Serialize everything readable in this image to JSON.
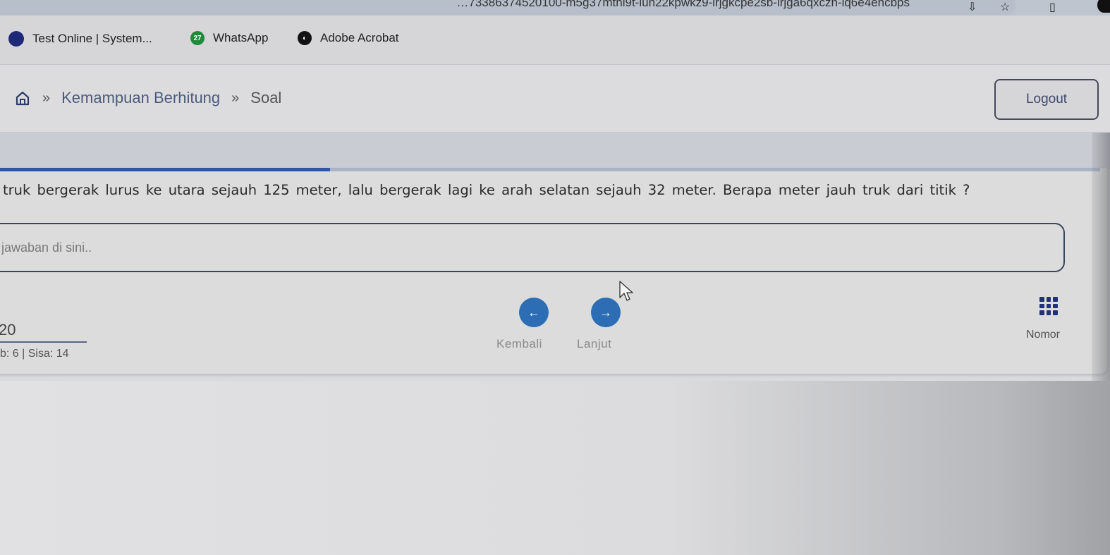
{
  "browser": {
    "url_fragment": "…73386374520100-m5g37mthi9t-lun22kpwkz9-lrjgkcpe2sb-lrjga6qxczn-lq6e4ehcbps",
    "icons": [
      "install-icon",
      "star-icon",
      "sidebar-icon",
      "profile-icon"
    ],
    "bookmarks": [
      {
        "label": "Test Online | System...",
        "icon": "site-icon",
        "color": "#1e2a78",
        "badge": ""
      },
      {
        "label": "WhatsApp",
        "icon": "whatsapp-icon",
        "color": "#1f8a3a",
        "badge": "27"
      },
      {
        "label": "Adobe Acrobat",
        "icon": "acrobat-icon",
        "color": "#111111",
        "badge": ""
      }
    ]
  },
  "header": {
    "breadcrumb": [
      {
        "label": "Kemampuan Berhitung"
      },
      {
        "label": "Soal"
      }
    ],
    "separator": "»",
    "logout_label": "Logout"
  },
  "quiz": {
    "progress_percent": 30,
    "question_text": "truk bergerak lurus ke utara sejauh 125 meter, lalu bergerak lagi ke arah selatan sejauh 32 meter. Berapa meter jauh truk dari titik ?",
    "answer_value": "",
    "answer_placeholder": "jawaban di sini..",
    "total_questions": "20",
    "status_text": "b: 6 | Sisa: 14",
    "prev_label": "Kembali",
    "next_label": "Lanjut",
    "number_label": "Nomor"
  },
  "colors": {
    "accent": "#2e56a8",
    "nav_button": "#2c6db4",
    "grid_icon": "#22307a"
  }
}
